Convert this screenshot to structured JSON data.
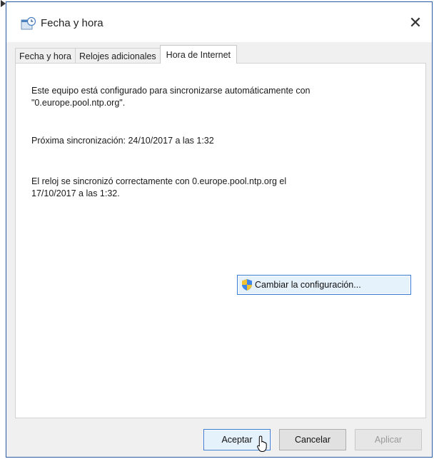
{
  "window": {
    "title": "Fecha y hora",
    "close_glyph": "✕",
    "icons": {
      "title": "clock-calendar-icon",
      "close": "close-icon"
    }
  },
  "tabs": [
    {
      "label": "Fecha y hora",
      "active": false
    },
    {
      "label": "Relojes adicionales",
      "active": false
    },
    {
      "label": "Hora de Internet",
      "active": true
    }
  ],
  "panel": {
    "sync_configured": "Este equipo está configurado para sincronizarse automáticamente con\n\"0.europe.pool.ntp.org\".",
    "next_sync": "Próxima sincronización: 24/10/2017 a las 1:32",
    "last_sync": "El reloj se sincronizó correctamente con 0.europe.pool.ntp.org el\n17/10/2017 a las 1:32.",
    "change_settings_label": "Cambiar la configuración...",
    "change_settings_icon": "uac-shield-icon"
  },
  "footer": {
    "ok_label": "Aceptar",
    "cancel_label": "Cancelar",
    "apply_label": "Aplicar"
  },
  "colors": {
    "accent_border": "#3a7bd5",
    "window_border": "#2b5fa8",
    "dialog_bg": "#f0f0f0",
    "panel_bg": "#ffffff",
    "disabled_text": "#9a9a9a"
  }
}
